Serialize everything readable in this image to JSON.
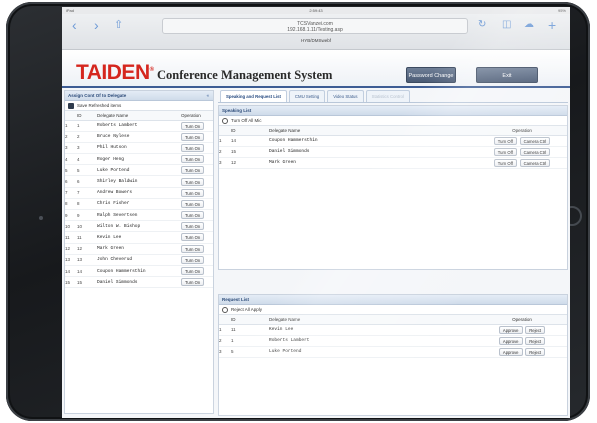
{
  "statusbar": {
    "carrier": "iPad",
    "time": "2:59:43",
    "battery": "95%"
  },
  "browser": {
    "url_line1": "TCSVanzei.com",
    "url_line2": "192.168.1.11/Testing.asp",
    "tab_title": "HYB/DMSwebf"
  },
  "app": {
    "logo": "TAIDEN",
    "title": "Conference Management System",
    "password_button": "Password Change",
    "exit_button": "Exit"
  },
  "left_panel": {
    "title": "Assign Cont Of to Delegate",
    "toolbar_label": "Save   Refreshed items",
    "columns": [
      "ID",
      "Delegate Name",
      "Operation"
    ],
    "rows": [
      {
        "idx": "1",
        "id": "1",
        "name": "Roberts Lambert",
        "op": "Turn On"
      },
      {
        "idx": "2",
        "id": "2",
        "name": "Bruce Nylese",
        "op": "Turn On"
      },
      {
        "idx": "3",
        "id": "3",
        "name": "Phil Hutson",
        "op": "Turn On"
      },
      {
        "idx": "4",
        "id": "4",
        "name": "Roger Heng",
        "op": "Turn On"
      },
      {
        "idx": "5",
        "id": "5",
        "name": "Luke Portend",
        "op": "Turn On"
      },
      {
        "idx": "6",
        "id": "6",
        "name": "Shirley Baldwin",
        "op": "Turn On"
      },
      {
        "idx": "7",
        "id": "7",
        "name": "Andrew Bowers",
        "op": "Turn On"
      },
      {
        "idx": "8",
        "id": "8",
        "name": "Chris Fisher",
        "op": "Turn On"
      },
      {
        "idx": "9",
        "id": "9",
        "name": "Ralph Severtsen",
        "op": "Turn On"
      },
      {
        "idx": "10",
        "id": "10",
        "name": "Wilton W. Bishop",
        "op": "Turn On"
      },
      {
        "idx": "11",
        "id": "11",
        "name": "Kevin Lee",
        "op": "Turn On"
      },
      {
        "idx": "12",
        "id": "12",
        "name": "Mark Green",
        "op": "Turn On"
      },
      {
        "idx": "13",
        "id": "13",
        "name": "John Cheverud",
        "op": "Turn On"
      },
      {
        "idx": "14",
        "id": "14",
        "name": "Coupon Hammersthin",
        "op": "Turn On"
      },
      {
        "idx": "15",
        "id": "15",
        "name": "Daniel Simmonds",
        "op": "Turn On"
      }
    ]
  },
  "tabs": [
    {
      "label": "Speaking and Request List",
      "active": true
    },
    {
      "label": "CMU Setting"
    },
    {
      "label": "Video Status"
    },
    {
      "label": "Statistics Control",
      "dim": true
    }
  ],
  "speaking": {
    "title": "Speaking List",
    "toolbar_label": "Turn Off All Mic",
    "columns": [
      "ID",
      "Delegate Name",
      "Operation"
    ],
    "rows": [
      {
        "idx": "1",
        "id": "14",
        "name": "Coupon Hammersthin",
        "op1": "Turn Off",
        "op2": "Camera Ctrl"
      },
      {
        "idx": "2",
        "id": "15",
        "name": "Daniel Simmonds",
        "op1": "Turn Off",
        "op2": "Camera Ctrl"
      },
      {
        "idx": "3",
        "id": "12",
        "name": "Mark Green",
        "op1": "Turn Off",
        "op2": "Camera Ctrl"
      }
    ]
  },
  "request": {
    "title": "Request List",
    "toolbar_label": "Reject All Apply",
    "columns": [
      "ID",
      "Delegate Name",
      "Operation"
    ],
    "rows": [
      {
        "idx": "1",
        "id": "11",
        "name": "Kevin Lee",
        "op1": "Approve",
        "op2": "Reject"
      },
      {
        "idx": "2",
        "id": "1",
        "name": "Roberts Lambert",
        "op1": "Approve",
        "op2": "Reject"
      },
      {
        "idx": "3",
        "id": "5",
        "name": "Luke Portend",
        "op1": "Approve",
        "op2": "Reject"
      }
    ]
  }
}
